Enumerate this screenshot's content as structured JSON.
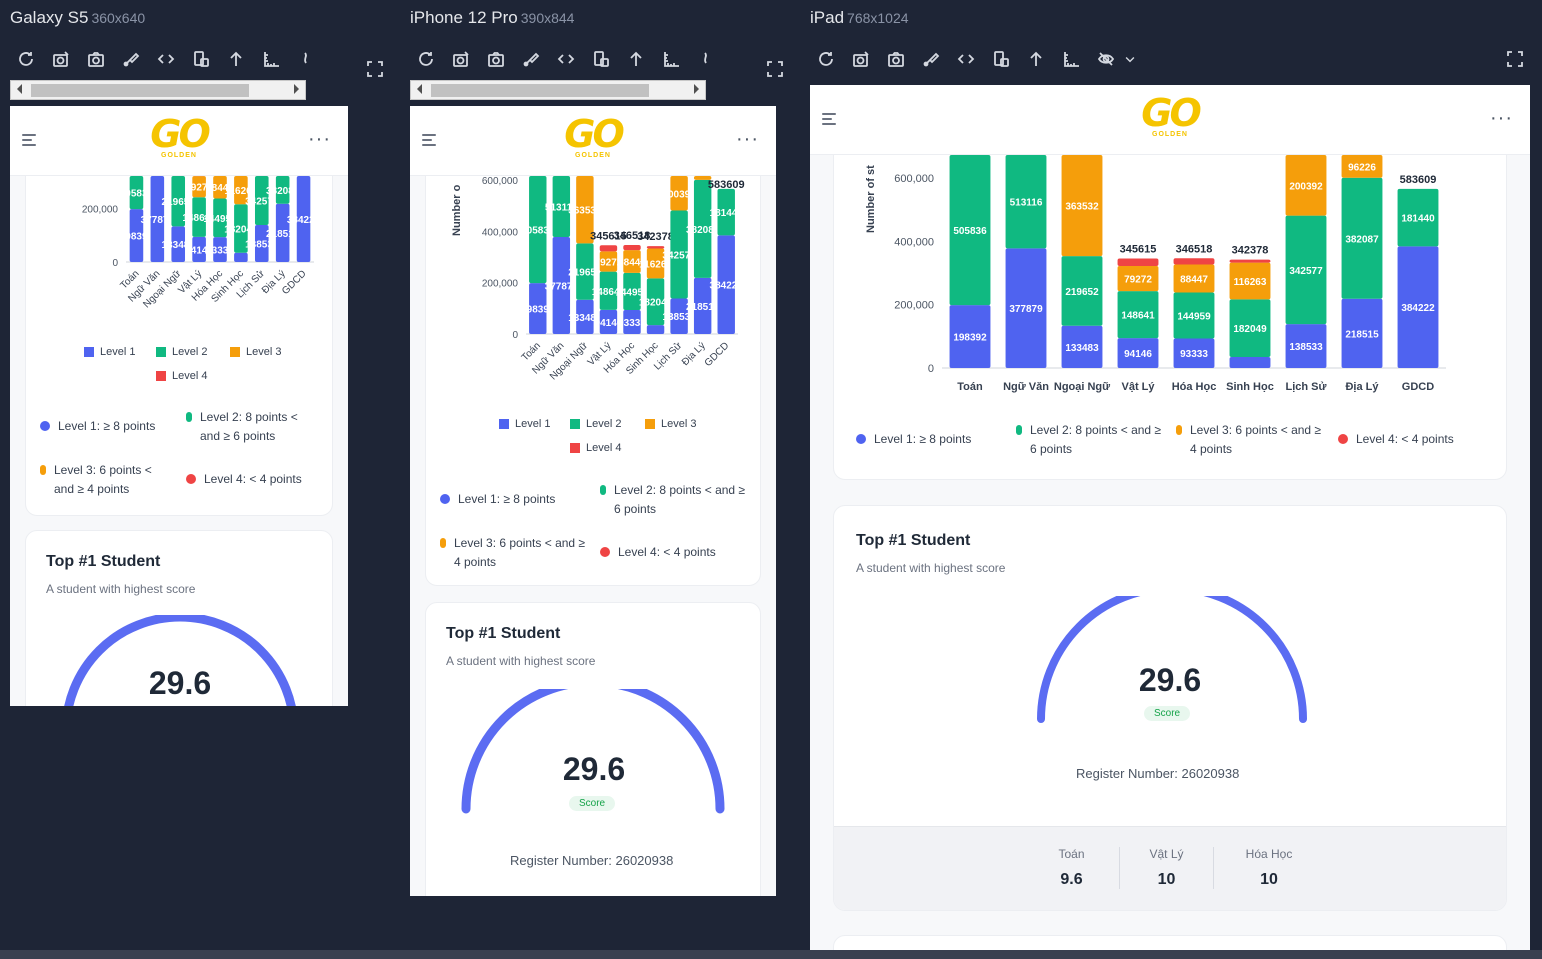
{
  "devices": [
    {
      "name": "Galaxy S5",
      "size": "360x640"
    },
    {
      "name": "iPhone 12 Pro",
      "size": "390x844"
    },
    {
      "name": "iPad",
      "size": "768x1024"
    }
  ],
  "toolbar_icons": [
    "refresh-icon",
    "camera-settings-icon",
    "camera-icon",
    "brush-icon",
    "code-icon",
    "rotate-device-icon",
    "upload-icon",
    "ruler-icon",
    "more-tools-icon"
  ],
  "ipad_extra_icon": "eye-off-icon",
  "logo": {
    "text": "GO",
    "sub": "GOLDEN",
    "color": "#f5c400"
  },
  "chart_data": {
    "type": "bar",
    "stacked": true,
    "categories": [
      "Toán",
      "Ngữ Văn",
      "Ngoại Ngữ",
      "Vật Lý",
      "Hóa Học",
      "Sinh Học",
      "Lịch Sử",
      "Địa Lý",
      "GDCD"
    ],
    "series": [
      {
        "name": "Level 1",
        "color": "#4f63f0",
        "values": [
          198392,
          377879,
          133483,
          94146,
          93333,
          34638,
          138533,
          218515,
          384222
        ]
      },
      {
        "name": "Level 2",
        "color": "#10b981",
        "values": [
          505836,
          513116,
          219652,
          148641,
          144959,
          182049,
          342577,
          382087,
          181440
        ]
      },
      {
        "name": "Level 3",
        "color": "#f59e0b",
        "values": [
          null,
          null,
          363532,
          79272,
          88447,
          116263,
          200392,
          96226,
          null
        ]
      },
      {
        "name": "Level 4",
        "color": "#ef4444",
        "values": [
          null,
          null,
          null,
          23556,
          19779,
          9428,
          null,
          null,
          null
        ]
      }
    ],
    "totals_shown": [
      "",
      "",
      "",
      "345615",
      "346518",
      "342378",
      "",
      "",
      "583609"
    ],
    "ylabel": "Number of st",
    "ylabel_tall": "Number o",
    "yticks": [
      "0",
      "200,000",
      "400,000",
      "600,000"
    ],
    "ylim": [
      0,
      600000
    ],
    "legend": [
      "Level 1",
      "Level 2",
      "Level 3",
      "Level 4"
    ]
  },
  "level_legend": [
    {
      "text": "Level 1: ≥ 8 points",
      "color": "#4f63f0"
    },
    {
      "text": "Level 2: 8 points < and ≥ 6 points",
      "color": "#10b981"
    },
    {
      "text": "Level 3: 6 points < and ≥ 4 points",
      "color": "#f59e0b"
    },
    {
      "text": "Level 4: < 4 points",
      "color": "#ef4444"
    }
  ],
  "top_student": {
    "title": "Top #1 Student",
    "subtitle": "A student with highest score",
    "score": "29.6",
    "score_label": "Score",
    "register": "Register Number: 26020938",
    "subjects": [
      {
        "name": "Toán",
        "score": "9.6"
      },
      {
        "name": "Vật Lý",
        "score": "10"
      },
      {
        "name": "Hóa Học",
        "score": "10"
      }
    ],
    "gauge_fraction": 1.0
  }
}
